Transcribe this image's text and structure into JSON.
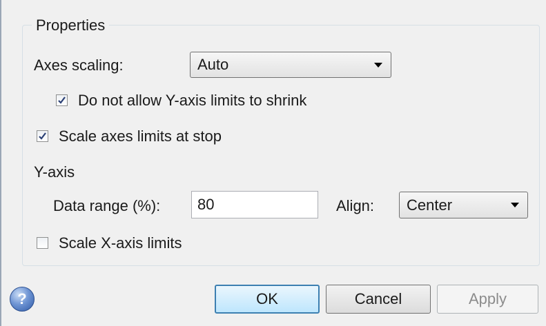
{
  "properties": {
    "group_title": "Properties",
    "axes_scaling_label": "Axes scaling:",
    "axes_scaling_value": "Auto",
    "no_shrink_label": "Do not allow Y-axis limits to shrink",
    "no_shrink_checked": true,
    "scale_at_stop_label": "Scale axes limits at stop",
    "scale_at_stop_checked": true,
    "yaxis_heading": "Y-axis",
    "data_range_label": "Data range (%):",
    "data_range_value": "80",
    "align_label": "Align:",
    "align_value": "Center",
    "scale_x_label": "Scale X-axis limits",
    "scale_x_checked": false
  },
  "footer": {
    "help_glyph": "?",
    "ok_label": "OK",
    "cancel_label": "Cancel",
    "apply_label": "Apply",
    "apply_enabled": false
  },
  "colors": {
    "default_button_border": "#3c7fb1",
    "help_icon": "#2f5aa6"
  }
}
